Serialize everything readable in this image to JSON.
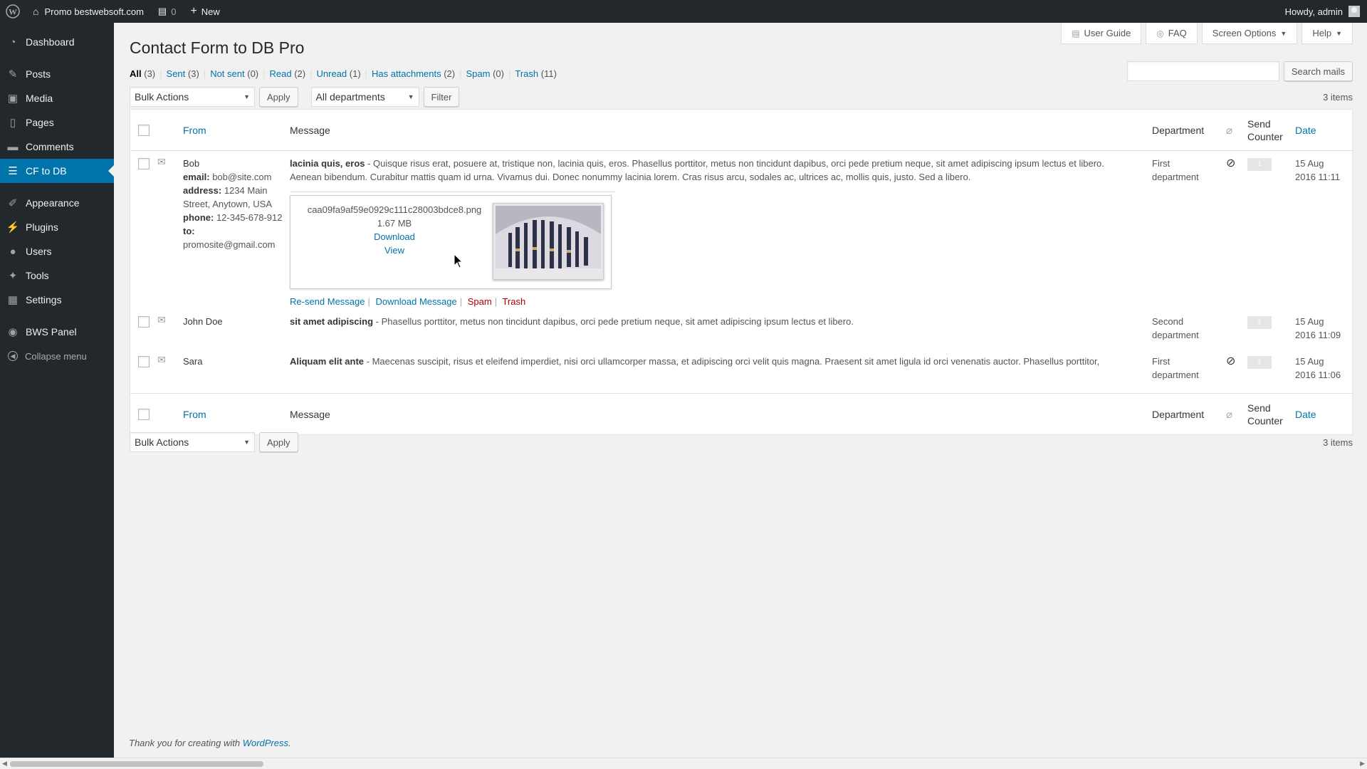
{
  "adminbar": {
    "site_name": "Promo bestwebsoft.com",
    "comments_count": "0",
    "new_label": "New",
    "howdy": "Howdy, admin"
  },
  "sidebar": {
    "items": [
      {
        "label": "Dashboard",
        "icon": "dashboard-icon"
      },
      {
        "label": "Posts",
        "icon": "pin-icon"
      },
      {
        "label": "Media",
        "icon": "media-icon"
      },
      {
        "label": "Pages",
        "icon": "pages-icon"
      },
      {
        "label": "Comments",
        "icon": "comments-icon"
      },
      {
        "label": "CF to DB",
        "icon": "database-icon"
      },
      {
        "label": "Appearance",
        "icon": "brush-icon"
      },
      {
        "label": "Plugins",
        "icon": "plugin-icon"
      },
      {
        "label": "Users",
        "icon": "users-icon"
      },
      {
        "label": "Tools",
        "icon": "wrench-icon"
      },
      {
        "label": "Settings",
        "icon": "settings-icon"
      },
      {
        "label": "BWS Panel",
        "icon": "bws-icon"
      }
    ],
    "collapse_label": "Collapse menu"
  },
  "screen_meta": {
    "user_guide": "User Guide",
    "faq": "FAQ",
    "screen_options": "Screen Options",
    "help": "Help"
  },
  "page": {
    "title": "Contact Form to DB Pro",
    "search_button": "Search mails",
    "items_count": "3 items"
  },
  "views": [
    {
      "label": "All",
      "count": "(3)"
    },
    {
      "label": "Sent",
      "count": "(3)"
    },
    {
      "label": "Not sent",
      "count": "(0)"
    },
    {
      "label": "Read",
      "count": "(2)"
    },
    {
      "label": "Unread",
      "count": "(1)"
    },
    {
      "label": "Has attachments",
      "count": "(2)"
    },
    {
      "label": "Spam",
      "count": "(0)"
    },
    {
      "label": "Trash",
      "count": "(11)"
    }
  ],
  "tablenav": {
    "bulk_actions": "Bulk Actions",
    "apply": "Apply",
    "departments": "All departments",
    "filter": "Filter"
  },
  "columns": {
    "from": "From",
    "message": "Message",
    "department": "Department",
    "send_counter_1": "Send",
    "send_counter_2": "Counter",
    "date": "Date"
  },
  "rows": [
    {
      "from": "Bob",
      "email_label": "email:",
      "email": "bob@site.com",
      "address_label": "address:",
      "address": "1234 Main Street, Anytown, USA",
      "phone_label": "phone:",
      "phone": "12-345-678-912",
      "to_label": "to:",
      "to": "promosite@gmail.com",
      "subject": "lacinia quis, eros",
      "message": " - Quisque risus erat, posuere at, tristique non, lacinia quis, eros. Phasellus porttitor, metus non tincidunt dapibus, orci pede pretium neque, sit amet adipiscing ipsum lectus et libero. Aenean bibendum. Curabitur mattis quam id urna. Vivamus dui. Donec nonummy lacinia lorem. Cras risus arcu, sodales ac, ultrices ac, mollis quis, justo. Sed a libero.",
      "department_1": "First",
      "department_2": "department",
      "counter": "1",
      "date_1": "15 Aug",
      "date_2": "2016 11:11",
      "attachment": {
        "filename": "caa09fa9af59e0929c111c28003bdce8.png",
        "size": "1.67 MB",
        "download": "Download",
        "view": "View"
      },
      "actions": {
        "resend": "Re-send Message",
        "download": "Download Message",
        "spam": "Spam",
        "trash": "Trash"
      }
    },
    {
      "from": "John Doe",
      "subject": "sit amet adipiscing",
      "message": " - Phasellus porttitor, metus non tincidunt dapibus, orci pede pretium neque, sit amet adipiscing ipsum lectus et libero.",
      "department_1": "Second",
      "department_2": "department",
      "counter": "1",
      "date_1": "15 Aug",
      "date_2": "2016 11:09"
    },
    {
      "from": "Sara",
      "subject": "Aliquam elit ante",
      "message": " - Maecenas suscipit, risus et eleifend imperdiet, nisi orci ullamcorper massa, et adipiscing orci velit quis magna. Praesent sit amet ligula id orci venenatis auctor. Phasellus porttitor,",
      "department_1": "First",
      "department_2": "department",
      "counter": "1",
      "date_1": "15 Aug",
      "date_2": "2016 11:06"
    }
  ],
  "footer": {
    "text": "Thank you for creating with ",
    "link": "WordPress",
    "end": "."
  },
  "colors": {
    "adminbar": "#23282d",
    "accent": "#0073aa",
    "danger": "#a00"
  }
}
